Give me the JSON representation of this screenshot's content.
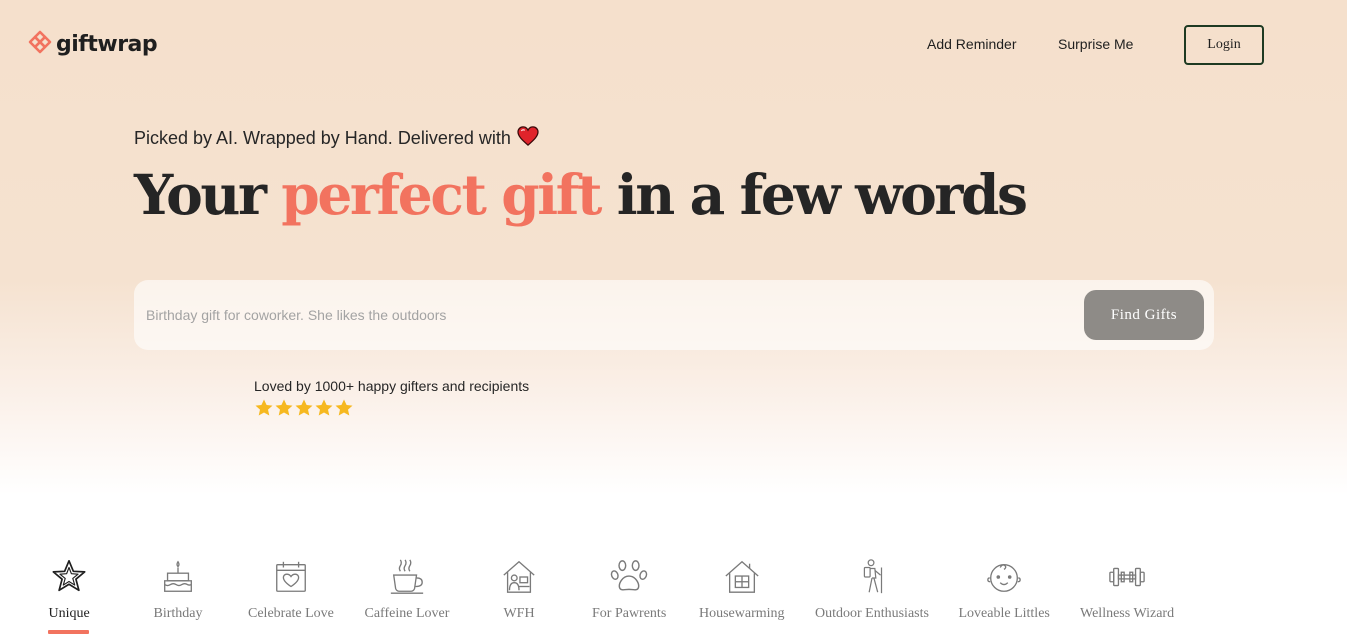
{
  "header": {
    "logo_text": "giftwrap",
    "nav": {
      "add_reminder": "Add Reminder",
      "surprise_me": "Surprise Me",
      "login": "Login"
    }
  },
  "hero": {
    "tagline": "Picked by AI. Wrapped by Hand. Delivered with",
    "headline_part1": "Your ",
    "headline_accent": "perfect gift",
    "headline_part2": " in a few words",
    "search_placeholder": "Birthday gift for coworker. She likes the outdoors",
    "search_value": "",
    "find_button": "Find Gifts",
    "social_proof": "Loved by 1000+ happy gifters and recipients",
    "rating_stars": 5
  },
  "categories": [
    {
      "label": "Unique",
      "icon": "star-icon",
      "active": true
    },
    {
      "label": "Birthday",
      "icon": "cake-icon",
      "active": false
    },
    {
      "label": "Celebrate Love",
      "icon": "calendar-heart-icon",
      "active": false
    },
    {
      "label": "Caffeine Lover",
      "icon": "coffee-cup-icon",
      "active": false
    },
    {
      "label": "WFH",
      "icon": "home-office-icon",
      "active": false
    },
    {
      "label": "For Pawrents",
      "icon": "paw-icon",
      "active": false
    },
    {
      "label": "Housewarming",
      "icon": "house-icon",
      "active": false
    },
    {
      "label": "Outdoor Enthusiasts",
      "icon": "hiker-icon",
      "active": false
    },
    {
      "label": "Loveable Littles",
      "icon": "baby-face-icon",
      "active": false
    },
    {
      "label": "Wellness Wizard",
      "icon": "dumbbell-icon",
      "active": false
    }
  ],
  "colors": {
    "accent": "#f2735f",
    "hero_background": "#f5e0cc",
    "login_border": "#1e3a22",
    "find_button_bg": "#8e8b87",
    "star": "#f6b81f",
    "heart": "#e0242b"
  }
}
